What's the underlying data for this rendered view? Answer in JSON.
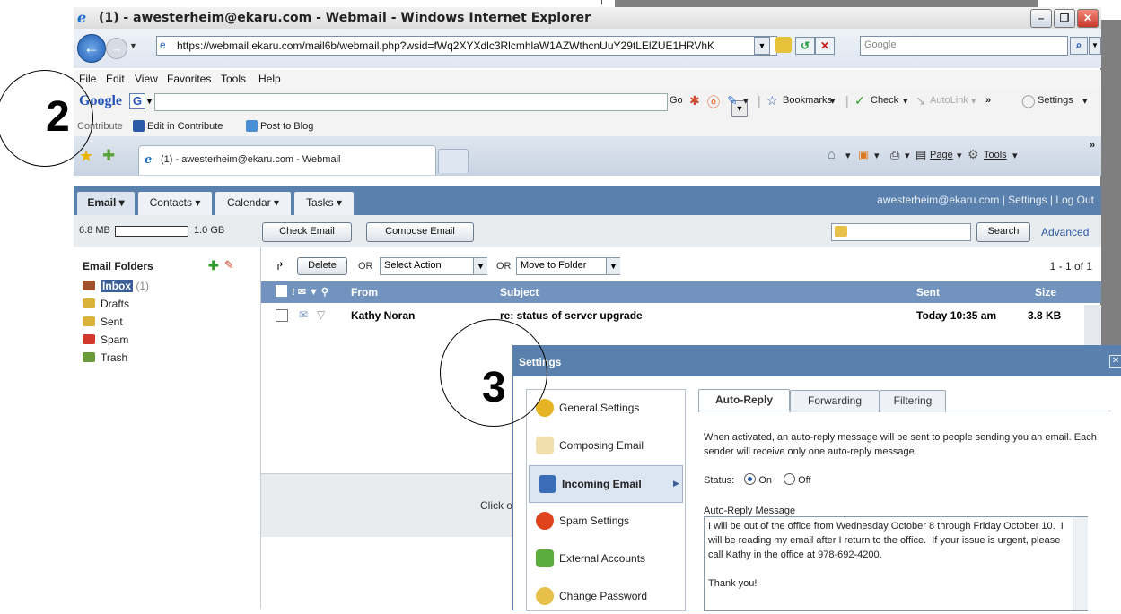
{
  "window": {
    "title": "(1) - awesterheim@ekaru.com - Webmail - Windows Internet Explorer"
  },
  "address_bar": {
    "url": "https://webmail.ekaru.com/mail6b/webmail.php?wsid=fWq2XYXdlc3RlcmhlaW1AZWthcnUuY29tLElZUE1HRVhK",
    "search_placeholder": "Google"
  },
  "menu": [
    "File",
    "Edit",
    "View",
    "Favorites",
    "Tools",
    "Help"
  ],
  "google_toolbar": {
    "logo": "Google",
    "go_label": "Go",
    "bookmarks_label": "Bookmarks",
    "check_label": "Check",
    "autolink_label": "AutoLink",
    "more_label": "»",
    "settings_label": "Settings"
  },
  "contribute_bar": {
    "contribute_label": "Contribute",
    "edit_label": "Edit in Contribute",
    "post_label": "Post to Blog"
  },
  "tab": {
    "label": "(1) - awesterheim@ekaru.com - Webmail"
  },
  "command_bar": {
    "page_label": "Page",
    "tools_label": "Tools",
    "more_label": "»"
  },
  "webmail": {
    "tabs": [
      "Email ▾",
      "Contacts ▾",
      "Calendar ▾",
      "Tasks ▾"
    ],
    "user_links": "awesterheim@ekaru.com  |  Settings  |  Log Out",
    "quota_used": "6.8 MB",
    "quota_total": "1.0 GB",
    "check_email": "Check Email",
    "compose_email": "Compose Email",
    "search_button": "Search",
    "advanced_link": "Advanced",
    "folders_title": "Email Folders",
    "folders": [
      {
        "name": "Inbox",
        "count": "(1)"
      },
      {
        "name": "Drafts"
      },
      {
        "name": "Sent"
      },
      {
        "name": "Spam"
      },
      {
        "name": "Trash"
      }
    ],
    "delete_button": "Delete",
    "or_label": "OR",
    "select_action": "Select Action",
    "move_to_folder": "Move to Folder",
    "pager": "1 - 1 of 1",
    "columns": {
      "from": "From",
      "subject": "Subject",
      "sent": "Sent",
      "size": "Size"
    },
    "messages": [
      {
        "from": "Kathy Noran",
        "subject": "re: status of server upgrade",
        "sent": "Today 10:35 am",
        "size": "3.8 KB"
      }
    ],
    "reading_pane_hint": "Click or"
  },
  "settings_dialog": {
    "title": "Settings",
    "nav": [
      "General Settings",
      "Composing Email",
      "Incoming Email",
      "Spam Settings",
      "External Accounts",
      "Change Password"
    ],
    "tabs": [
      "Auto-Reply",
      "Forwarding",
      "Filtering"
    ],
    "description": "When activated, an auto-reply message will be sent to people sending you an email. Each sender will receive only one auto-reply message.",
    "status_label": "Status:",
    "status_on": "On",
    "status_off": "Off",
    "message_label": "Auto-Reply Message",
    "message_text": "I will be out of the office from Wednesday October 8 through Friday October 10.  I will be reading my email after I return to the office.  If your issue is urgent, please call Kathy in the office at 978-692-4200.\n\nThank you!"
  },
  "callouts": {
    "one": "2",
    "two": "3"
  }
}
